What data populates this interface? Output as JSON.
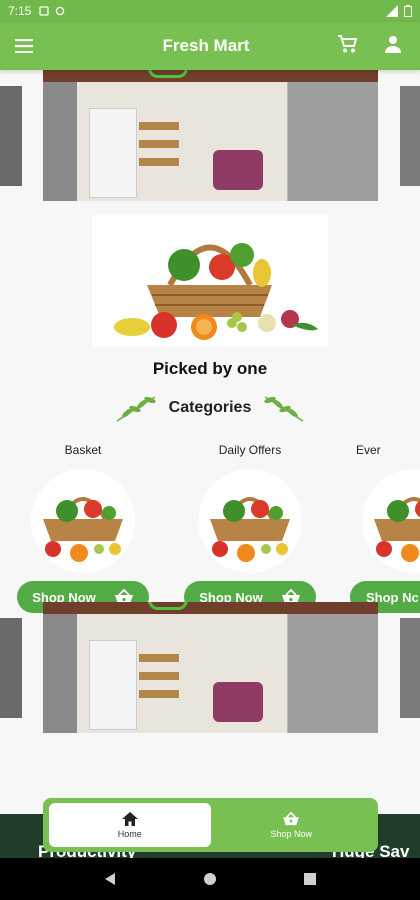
{
  "status_bar": {
    "time": "7:15"
  },
  "app_bar": {
    "title": "Fresh Mart"
  },
  "hero": {
    "caption": "Picked by one"
  },
  "categories": {
    "heading": "Categories",
    "items": [
      {
        "name": "Basket",
        "button": "Shop Now"
      },
      {
        "name": "Daily Offers",
        "button": "Shop Now"
      },
      {
        "name": "Ever",
        "button": "Shop Nc"
      }
    ]
  },
  "footer_banner": {
    "left_text": "Productivity",
    "right_text": "Huge Sav"
  },
  "bottom_nav": {
    "items": [
      {
        "label": "Home"
      },
      {
        "label": "Shop Now"
      }
    ]
  },
  "colors": {
    "status_bar": "#70b94a",
    "app_bar": "#78c051",
    "button": "#52ab45"
  }
}
